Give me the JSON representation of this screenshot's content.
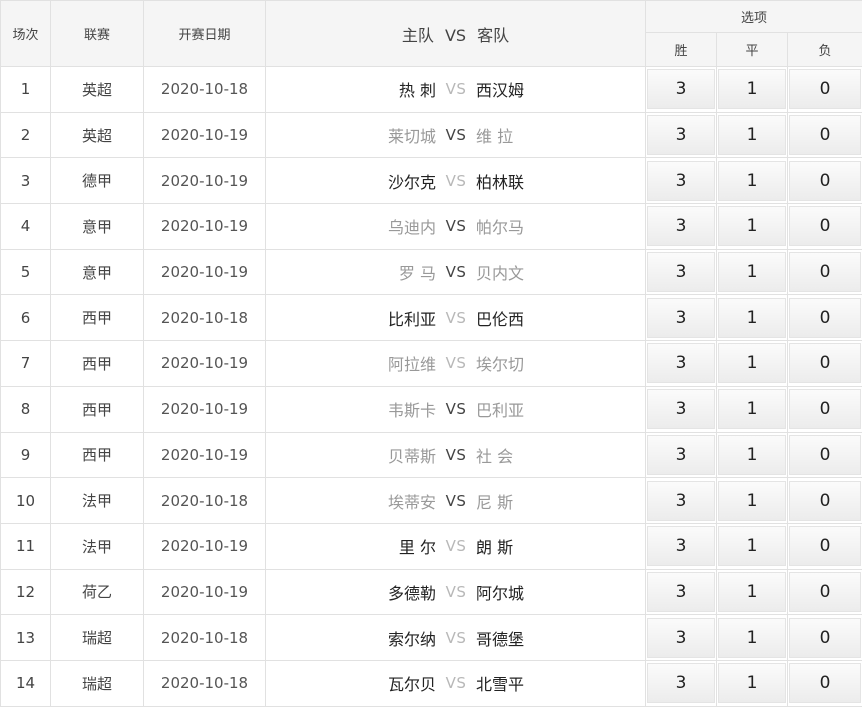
{
  "header": {
    "col_no": "场次",
    "col_league": "联赛",
    "col_date": "开赛日期",
    "col_home": "主队",
    "col_vs": "VS",
    "col_away": "客队",
    "col_options": "选项",
    "opt_win": "胜",
    "opt_draw": "平",
    "opt_lose": "负"
  },
  "rows": [
    {
      "no": "1",
      "league": "英超",
      "date": "2020-10-18",
      "home": "热 刺",
      "vs": "VS",
      "away": "西汉姆",
      "win": "3",
      "draw": "1",
      "lose": "0",
      "home_style": "dark",
      "vs_style": "light",
      "away_style": "dark"
    },
    {
      "no": "2",
      "league": "英超",
      "date": "2020-10-19",
      "home": "莱切城",
      "vs": "VS",
      "away": "维 拉",
      "win": "3",
      "draw": "1",
      "lose": "0",
      "home_style": "light",
      "vs_style": "dark",
      "away_style": "light"
    },
    {
      "no": "3",
      "league": "德甲",
      "date": "2020-10-19",
      "home": "沙尔克",
      "vs": "VS",
      "away": "柏林联",
      "win": "3",
      "draw": "1",
      "lose": "0",
      "home_style": "dark",
      "vs_style": "light",
      "away_style": "dark"
    },
    {
      "no": "4",
      "league": "意甲",
      "date": "2020-10-19",
      "home": "乌迪内",
      "vs": "VS",
      "away": "帕尔马",
      "win": "3",
      "draw": "1",
      "lose": "0",
      "home_style": "light",
      "vs_style": "dark",
      "away_style": "light"
    },
    {
      "no": "5",
      "league": "意甲",
      "date": "2020-10-19",
      "home": "罗 马",
      "vs": "VS",
      "away": "贝内文",
      "win": "3",
      "draw": "1",
      "lose": "0",
      "home_style": "light",
      "vs_style": "dark",
      "away_style": "light"
    },
    {
      "no": "6",
      "league": "西甲",
      "date": "2020-10-18",
      "home": "比利亚",
      "vs": "VS",
      "away": "巴伦西",
      "win": "3",
      "draw": "1",
      "lose": "0",
      "home_style": "dark",
      "vs_style": "light",
      "away_style": "dark"
    },
    {
      "no": "7",
      "league": "西甲",
      "date": "2020-10-19",
      "home": "阿拉维",
      "vs": "VS",
      "away": "埃尔切",
      "win": "3",
      "draw": "1",
      "lose": "0",
      "home_style": "light",
      "vs_style": "light",
      "away_style": "light"
    },
    {
      "no": "8",
      "league": "西甲",
      "date": "2020-10-19",
      "home": "韦斯卡",
      "vs": "VS",
      "away": "巴利亚",
      "win": "3",
      "draw": "1",
      "lose": "0",
      "home_style": "light",
      "vs_style": "dark",
      "away_style": "light"
    },
    {
      "no": "9",
      "league": "西甲",
      "date": "2020-10-19",
      "home": "贝蒂斯",
      "vs": "VS",
      "away": "社 会",
      "win": "3",
      "draw": "1",
      "lose": "0",
      "home_style": "light",
      "vs_style": "dark",
      "away_style": "light"
    },
    {
      "no": "10",
      "league": "法甲",
      "date": "2020-10-18",
      "home": "埃蒂安",
      "vs": "VS",
      "away": "尼 斯",
      "win": "3",
      "draw": "1",
      "lose": "0",
      "home_style": "light",
      "vs_style": "dark",
      "away_style": "light"
    },
    {
      "no": "11",
      "league": "法甲",
      "date": "2020-10-19",
      "home": "里 尔",
      "vs": "VS",
      "away": "朗 斯",
      "win": "3",
      "draw": "1",
      "lose": "0",
      "home_style": "dark",
      "vs_style": "light",
      "away_style": "dark"
    },
    {
      "no": "12",
      "league": "荷乙",
      "date": "2020-10-19",
      "home": "多德勒",
      "vs": "VS",
      "away": "阿尔城",
      "win": "3",
      "draw": "1",
      "lose": "0",
      "home_style": "dark",
      "vs_style": "light",
      "away_style": "dark"
    },
    {
      "no": "13",
      "league": "瑞超",
      "date": "2020-10-18",
      "home": "索尔纳",
      "vs": "VS",
      "away": "哥德堡",
      "win": "3",
      "draw": "1",
      "lose": "0",
      "home_style": "dark",
      "vs_style": "light",
      "away_style": "dark"
    },
    {
      "no": "14",
      "league": "瑞超",
      "date": "2020-10-18",
      "home": "瓦尔贝",
      "vs": "VS",
      "away": "北雪平",
      "win": "3",
      "draw": "1",
      "lose": "0",
      "home_style": "dark",
      "vs_style": "light",
      "away_style": "dark"
    }
  ]
}
